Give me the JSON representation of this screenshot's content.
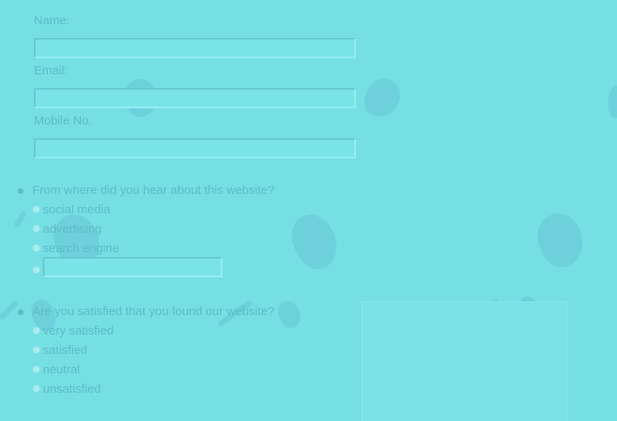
{
  "form": {
    "name_label": "Name:",
    "name_value": "",
    "email_label": "Email:",
    "email_value": "",
    "mobile_label": "Mobile No.",
    "mobile_value": ""
  },
  "questions": {
    "source": {
      "prompt": "From where did you hear about this website?",
      "options": [
        "social media",
        "advertising",
        "search engine"
      ],
      "other_value": ""
    },
    "satisfaction": {
      "prompt": "Are you satisfied that you found our website?",
      "options": [
        "very satisfied",
        "satisfied",
        "neutral",
        "unsatisfied"
      ]
    }
  },
  "colors": {
    "background": "#76dfe4",
    "text": "#5cbcc6",
    "decoration": "#6ccfda"
  }
}
